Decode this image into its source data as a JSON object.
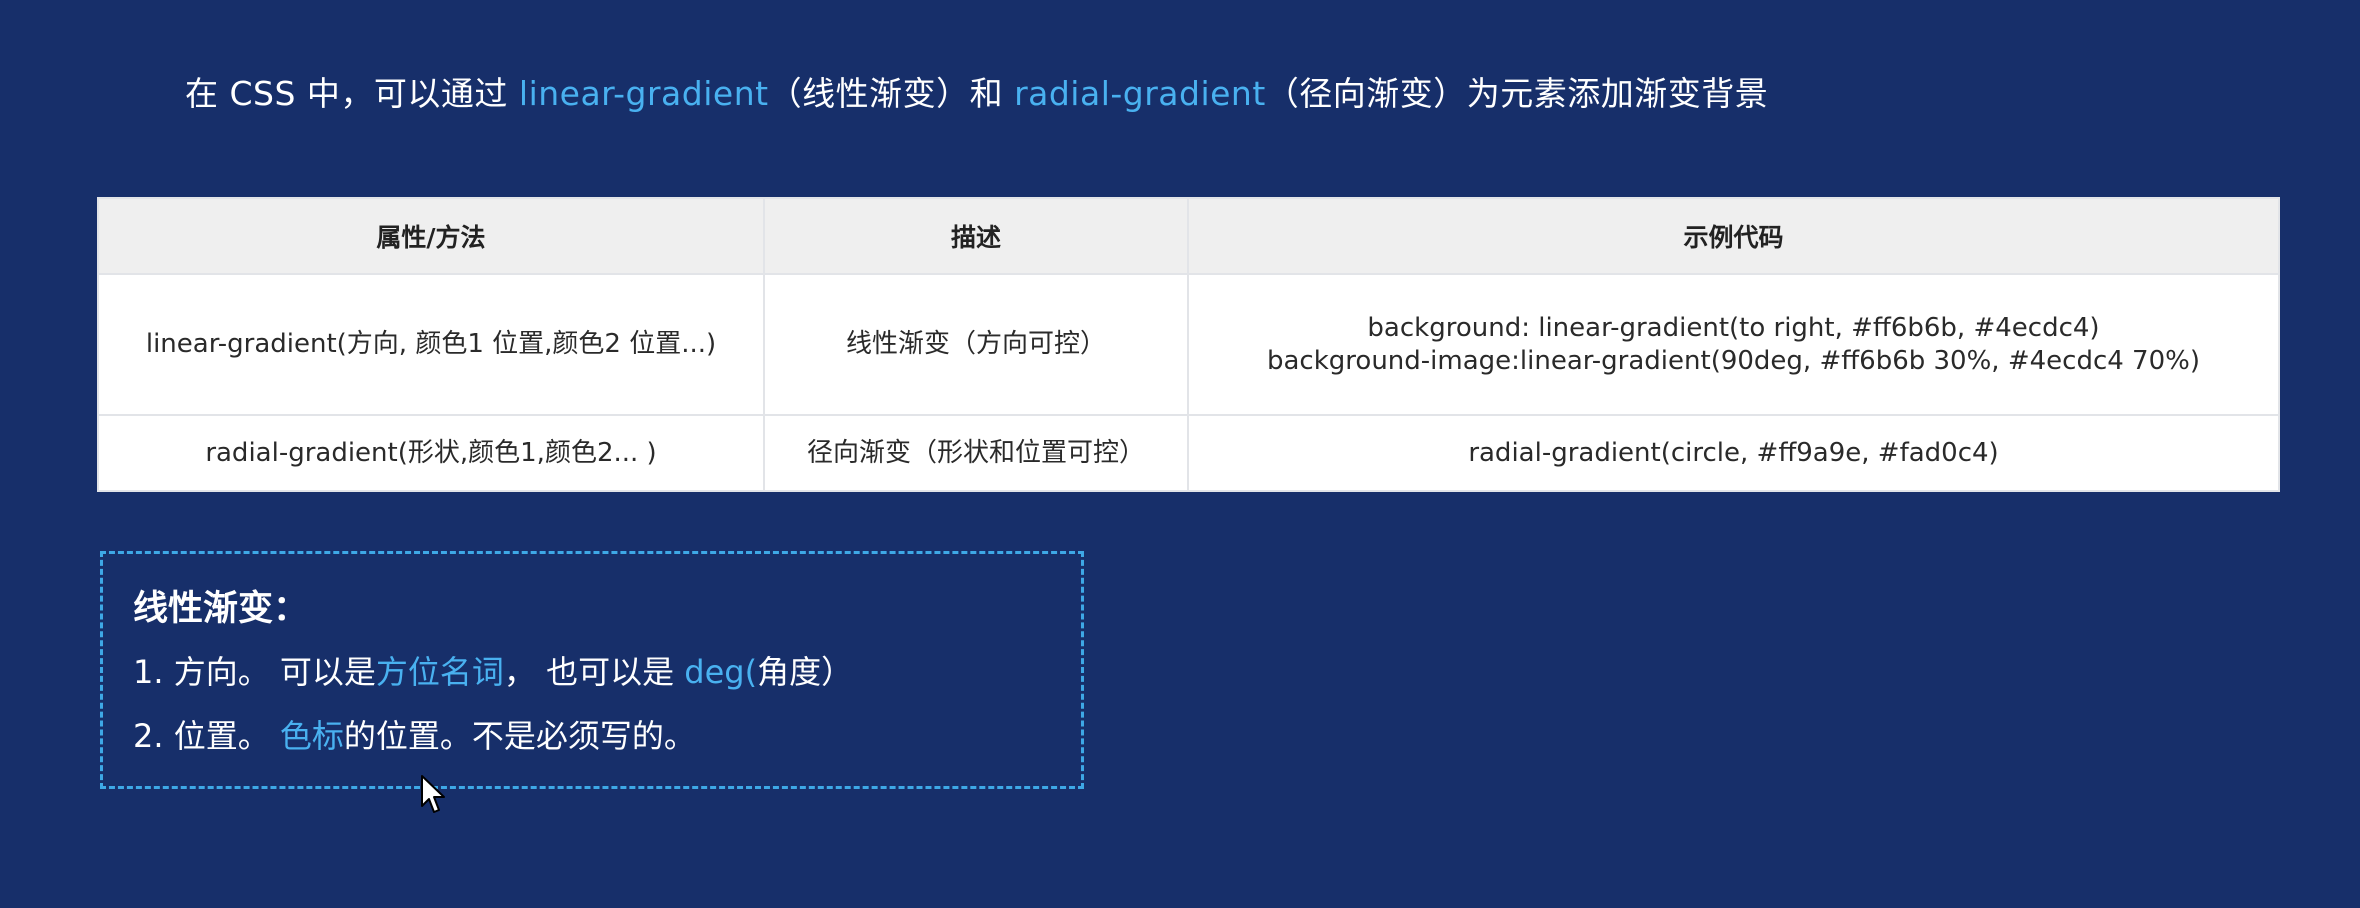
{
  "intro": {
    "part1": "在 CSS 中，可以通过 ",
    "linear": "linear-gradient",
    "part2": "（线性渐变）和 ",
    "radial": "radial-gradient",
    "part3": "（径向渐变）为元素添加渐变背景"
  },
  "table": {
    "headers": [
      "属性/方法",
      "描述",
      "示例代码"
    ],
    "rows": [
      {
        "property": "linear-gradient(方向, 颜色1  位置,颜色2  位置...)",
        "description": "线性渐变（方向可控）",
        "code": [
          "background: linear-gradient(to right, #ff6b6b, #4ecdc4)",
          "background-image:linear-gradient(90deg, #ff6b6b 30%, #4ecdc4 70%)"
        ]
      },
      {
        "property": "radial-gradient(形状,颜色1,颜色2... )",
        "description": "径向渐变（形状和位置可控）",
        "code": [
          "radial-gradient(circle, #ff9a9e, #fad0c4)"
        ]
      }
    ]
  },
  "note": {
    "title": "线性渐变：",
    "line1": {
      "a": "1. 方向。  可以是",
      "b": "方位名词",
      "c": "， 也可以是  ",
      "d": "deg(",
      "e": "角度）"
    },
    "line2": {
      "a": "2. 位置。 ",
      "b": "色标",
      "c": "的位置。不是必须写的。"
    }
  },
  "colors": {
    "background": "#172f6a",
    "highlight": "#49b1f0",
    "dashed_border": "#3ea8e6",
    "table_header_bg": "#efefef"
  },
  "icons": {
    "cursor": "mouse-pointer-icon"
  }
}
